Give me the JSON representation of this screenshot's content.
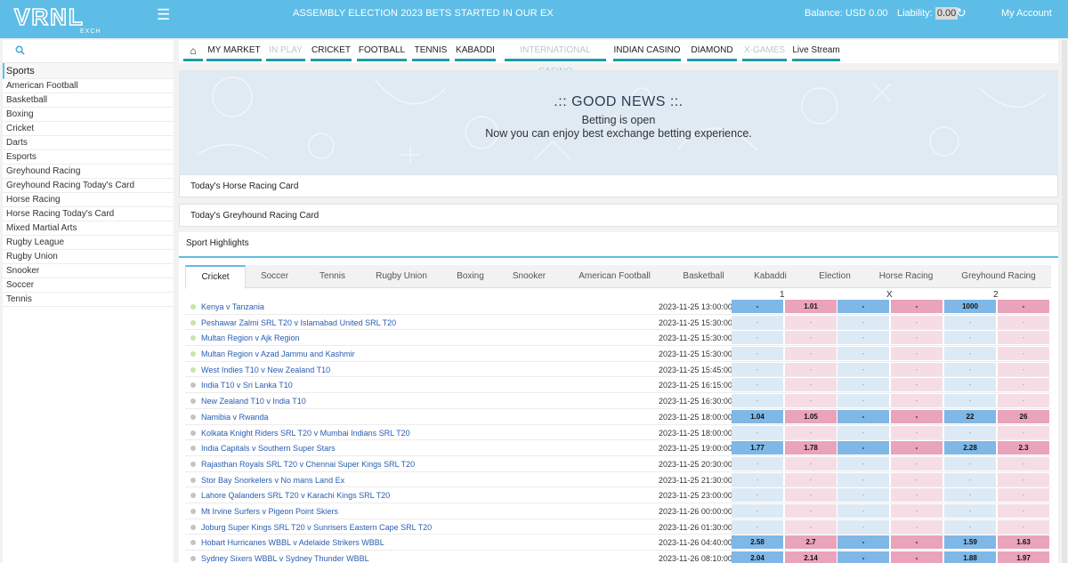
{
  "header": {
    "logo_text": "VRNL",
    "logo_subtext": "EXCH",
    "ticker": "ASSEMBLY ELECTION 2023 BETS STARTED IN OUR EX",
    "balance": "Balance: USD 0.00",
    "liability_label": "Liability:",
    "liability_value": "0.00",
    "account": "My Account"
  },
  "sidebar": {
    "items": [
      "Sports",
      "American Football",
      "Basketball",
      "Boxing",
      "Cricket",
      "Darts",
      "Esports",
      "Greyhound Racing",
      "Greyhound Racing Today's Card",
      "Horse Racing",
      "Horse Racing Today's Card",
      "Mixed Martial Arts",
      "Rugby League",
      "Rugby Union",
      "Snooker",
      "Soccer",
      "Tennis"
    ]
  },
  "nav": {
    "tabs": [
      "MY MARKET",
      "IN PLAY",
      "CRICKET",
      "FOOTBALL",
      "TENNIS",
      "KABADDI",
      "INTERNATIONAL CASINO",
      "INDIAN CASINO",
      "DIAMOND",
      "X-GAMES",
      "Live Stream"
    ]
  },
  "banner": {
    "title": ".:: GOOD NEWS ::.",
    "line1": "Betting is open",
    "line2": "Now you can enjoy best exchange betting experience."
  },
  "cards": {
    "horse": "Today's Horse Racing Card",
    "greyhound": "Today's Greyhound Racing Card",
    "highlights": "Sport Highlights"
  },
  "sport_tabs": [
    "Cricket",
    "Soccer",
    "Tennis",
    "Rugby Union",
    "Boxing",
    "Snooker",
    "American Football",
    "Basketball",
    "Kabaddi",
    "Election",
    "Horse Racing",
    "Greyhound Racing"
  ],
  "columns": {
    "one": "1",
    "x": "X",
    "two": "2"
  },
  "matches": [
    {
      "name": "Kenya v Tanzania",
      "time": "2023-11-25 13:00:00",
      "live": true,
      "odds": [
        "-",
        "1.01",
        "-",
        "-",
        "1000",
        "-"
      ],
      "active": true
    },
    {
      "name": "Peshawar Zalmi SRL T20 v Islamabad United SRL T20",
      "time": "2023-11-25 15:30:00",
      "live": true,
      "odds": [
        "-",
        "-",
        "-",
        "-",
        "-",
        "-"
      ],
      "active": false
    },
    {
      "name": "Multan Region v Ajk Region",
      "time": "2023-11-25 15:30:00",
      "live": true,
      "odds": [
        "-",
        "-",
        "-",
        "-",
        "-",
        "-"
      ],
      "active": false
    },
    {
      "name": "Multan Region v Azad Jammu and Kashmir",
      "time": "2023-11-25 15:30:00",
      "live": true,
      "odds": [
        "-",
        "-",
        "-",
        "-",
        "-",
        "-"
      ],
      "active": false
    },
    {
      "name": "West Indies T10 v New Zealand T10",
      "time": "2023-11-25 15:45:00",
      "live": true,
      "odds": [
        "-",
        "-",
        "-",
        "-",
        "-",
        "-"
      ],
      "active": false
    },
    {
      "name": "India T10 v Sri Lanka T10",
      "time": "2023-11-25 16:15:00",
      "live": false,
      "odds": [
        "-",
        "-",
        "-",
        "-",
        "-",
        "-"
      ],
      "active": false
    },
    {
      "name": "New Zealand T10 v India T10",
      "time": "2023-11-25 16:30:00",
      "live": false,
      "odds": [
        "-",
        "-",
        "-",
        "-",
        "-",
        "-"
      ],
      "active": false
    },
    {
      "name": "Namibia v Rwanda",
      "time": "2023-11-25 18:00:00",
      "live": false,
      "odds": [
        "1.04",
        "1.05",
        "-",
        "-",
        "22",
        "26"
      ],
      "active": true
    },
    {
      "name": "Kolkata Knight Riders SRL T20 v Mumbai Indians SRL T20",
      "time": "2023-11-25 18:00:00",
      "live": false,
      "odds": [
        "-",
        "-",
        "-",
        "-",
        "-",
        "-"
      ],
      "active": false
    },
    {
      "name": "India Capitals v Southern Super Stars",
      "time": "2023-11-25 19:00:00",
      "live": false,
      "odds": [
        "1.77",
        "1.78",
        "-",
        "-",
        "2.28",
        "2.3"
      ],
      "active": true
    },
    {
      "name": "Rajasthan Royals SRL T20 v Chennai Super Kings SRL T20",
      "time": "2023-11-25 20:30:00",
      "live": false,
      "odds": [
        "-",
        "-",
        "-",
        "-",
        "-",
        "-"
      ],
      "active": false
    },
    {
      "name": "Stor Bay Snorkelers v No mans Land Ex",
      "time": "2023-11-25 21:30:00",
      "live": false,
      "odds": [
        "-",
        "-",
        "-",
        "-",
        "-",
        "-"
      ],
      "active": false
    },
    {
      "name": "Lahore Qalanders SRL T20 v Karachi Kings SRL T20",
      "time": "2023-11-25 23:00:00",
      "live": false,
      "odds": [
        "-",
        "-",
        "-",
        "-",
        "-",
        "-"
      ],
      "active": false
    },
    {
      "name": "Mt Irvine Surfers v Pigeon Point Skiers",
      "time": "2023-11-26 00:00:00",
      "live": false,
      "odds": [
        "-",
        "-",
        "-",
        "-",
        "-",
        "-"
      ],
      "active": false
    },
    {
      "name": "Joburg Super Kings SRL T20 v Sunrisers Eastern Cape SRL T20",
      "time": "2023-11-26 01:30:00",
      "live": false,
      "odds": [
        "-",
        "-",
        "-",
        "-",
        "-",
        "-"
      ],
      "active": false
    },
    {
      "name": "Hobart Hurricanes WBBL v Adelaide Strikers WBBL",
      "time": "2023-11-26 04:40:00",
      "live": false,
      "odds": [
        "2.58",
        "2.7",
        "-",
        "-",
        "1.59",
        "1.63"
      ],
      "active": true
    },
    {
      "name": "Sydney Sixers WBBL v Sydney Thunder WBBL",
      "time": "2023-11-26 08:10:00",
      "live": false,
      "odds": [
        "2.04",
        "2.14",
        "-",
        "-",
        "1.88",
        "1.97"
      ],
      "active": true
    }
  ],
  "colors": {
    "header_bg": "#5ebde6",
    "nav_underline": "#179fa8",
    "back_active": "#7fb7e6",
    "lay_active": "#e9a3bb",
    "back_idle": "#dceaf6",
    "lay_idle": "#f6dde5",
    "link": "#2a5db0"
  },
  "icons": {
    "menu": "hamburger-icon",
    "refresh": "refresh-icon",
    "search": "search-icon",
    "home": "home-icon"
  }
}
